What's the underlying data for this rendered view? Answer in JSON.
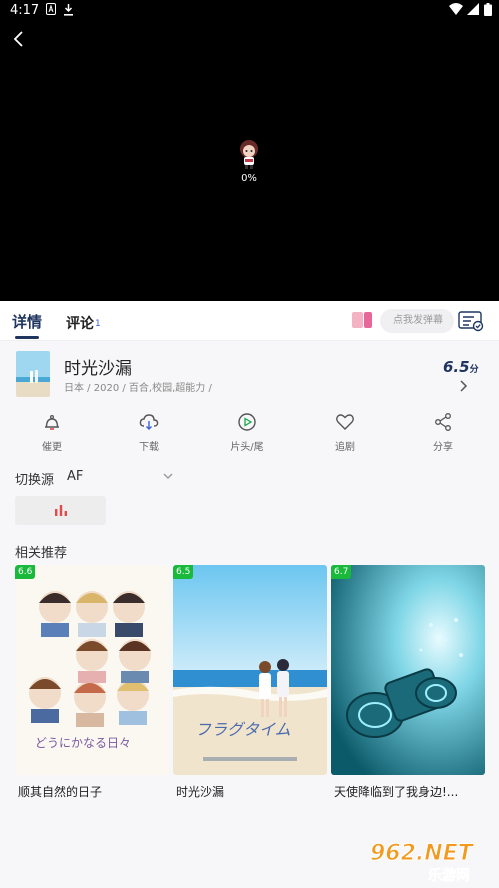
{
  "status_bar": {
    "time": "4:17"
  },
  "player": {
    "progress_text": "0%"
  },
  "tabs": {
    "details": "详情",
    "comments": "评论",
    "comments_count": "1"
  },
  "danmaku": {
    "placeholder": "点我发弹幕"
  },
  "show": {
    "title": "时光沙漏",
    "meta": "日本 / 2020 / 百合,校园,超能力 /",
    "score": "6.5",
    "score_unit": "分"
  },
  "actions": [
    {
      "label": "催更",
      "icon": "bell-icon"
    },
    {
      "label": "下载",
      "icon": "cloud-download-icon"
    },
    {
      "label": "片头/尾",
      "icon": "play-circle-icon"
    },
    {
      "label": "追剧",
      "icon": "heart-icon"
    },
    {
      "label": "分享",
      "icon": "share-icon"
    }
  ],
  "source": {
    "label": "切换源",
    "value": "AF"
  },
  "recommend": {
    "label": "相关推荐",
    "items": [
      {
        "title": "顺其自然的日子",
        "score": "6.6"
      },
      {
        "title": "时光沙漏",
        "score": "6.5"
      },
      {
        "title": "天使降临到了我身边!...",
        "score": "6.7"
      }
    ]
  },
  "watermark": {
    "text": "962.NET",
    "subtext": "乐游网"
  },
  "colors": {
    "accent": "#1f3560",
    "badge": "#19b93b",
    "link": "#3c63d8"
  }
}
